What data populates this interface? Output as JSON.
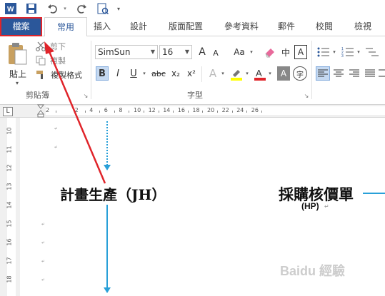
{
  "qat": {
    "app_icon": "word-icon",
    "save_icon": "save-icon",
    "undo_icon": "undo-icon",
    "redo_icon": "redo-icon",
    "print_icon": "print-preview-icon",
    "more_icon": "customize-qat-icon"
  },
  "tabs": [
    {
      "label": "檔案"
    },
    {
      "label": "常用"
    },
    {
      "label": "插入"
    },
    {
      "label": "設計"
    },
    {
      "label": "版面配置"
    },
    {
      "label": "參考資料"
    },
    {
      "label": "郵件"
    },
    {
      "label": "校閱"
    },
    {
      "label": "檢視"
    }
  ],
  "clipboard": {
    "paste_label": "貼上",
    "cut_label": "剪下",
    "copy_label": "複製",
    "format_painter_label": "複製格式",
    "group_label": "剪貼簿"
  },
  "font": {
    "font_name": "SimSun",
    "font_size": "16",
    "grow_label": "A",
    "shrink_label": "A",
    "case_label": "Aa",
    "bold": "B",
    "italic": "I",
    "underline": "U",
    "strike": "abc",
    "subscript": "x₂",
    "superscript": "x²",
    "group_label": "字型",
    "phonetic_label": "中",
    "char_border_label": "A",
    "char_shade_label": "A",
    "encircle_label": "字",
    "colors": {
      "highlight": "#ffff00",
      "font_color": "#e0242a"
    }
  },
  "ruler": {
    "ticks": [
      "2",
      "2",
      "4",
      "6",
      "8",
      "10",
      "12",
      "14",
      "16",
      "18",
      "20",
      "22",
      "24",
      "26"
    ]
  },
  "vruler": {
    "numbers": [
      "10",
      "11",
      "12",
      "13",
      "14",
      "15",
      "16",
      "17",
      "18"
    ]
  },
  "document": {
    "text1": "計畫生產（JH）",
    "text2": "採購核價單",
    "text3": "(HP)"
  },
  "watermark": "Baidu 經驗"
}
